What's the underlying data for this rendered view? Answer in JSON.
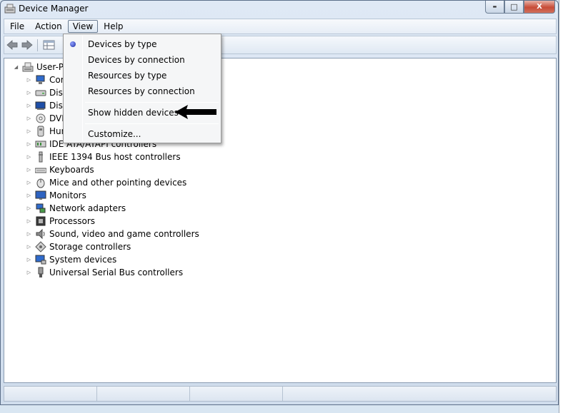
{
  "window": {
    "title": "Device Manager"
  },
  "caption": {
    "minimize": "▬",
    "maximize": "□",
    "close": "X"
  },
  "menubar": {
    "items": [
      "File",
      "Action",
      "View",
      "Help"
    ]
  },
  "tree": {
    "root": "User-PC",
    "nodes": [
      {
        "label": "Computer",
        "icon": "computer-icon"
      },
      {
        "label": "Disk drives",
        "icon": "disk-drive-icon"
      },
      {
        "label": "Display adapters",
        "icon": "display-adapter-icon"
      },
      {
        "label": "DVD/CD-ROM drives",
        "icon": "dvd-drive-icon"
      },
      {
        "label": "Human Interface Devices",
        "icon": "hid-icon"
      },
      {
        "label": "IDE ATA/ATAPI controllers",
        "icon": "ide-controller-icon"
      },
      {
        "label": "IEEE 1394 Bus host controllers",
        "icon": "ieee1394-icon"
      },
      {
        "label": "Keyboards",
        "icon": "keyboard-icon"
      },
      {
        "label": "Mice and other pointing devices",
        "icon": "mouse-icon"
      },
      {
        "label": "Monitors",
        "icon": "monitor-icon"
      },
      {
        "label": "Network adapters",
        "icon": "network-adapter-icon"
      },
      {
        "label": "Processors",
        "icon": "processor-icon"
      },
      {
        "label": "Sound, video and game controllers",
        "icon": "sound-icon"
      },
      {
        "label": "Storage controllers",
        "icon": "storage-controller-icon"
      },
      {
        "label": "System devices",
        "icon": "system-device-icon"
      },
      {
        "label": "Universal Serial Bus controllers",
        "icon": "usb-icon"
      }
    ]
  },
  "view_menu": {
    "selected": "Devices by type",
    "items": [
      "Devices by type",
      "Devices by connection",
      "Resources by type",
      "Resources by connection",
      "Show hidden devices",
      "Customize..."
    ]
  },
  "colors": {
    "accent": "#1b2a9e",
    "window_frame": "#5c6f89",
    "close_button": "#c74b37"
  }
}
